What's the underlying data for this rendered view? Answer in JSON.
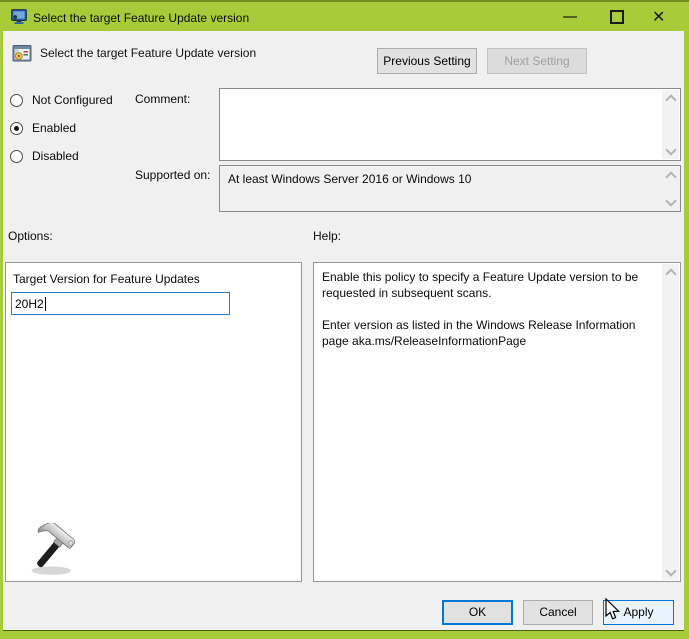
{
  "window": {
    "title": "Select the target Feature Update version",
    "controls": {
      "minimize": "minimize",
      "maximize": "maximize",
      "close": "✕"
    }
  },
  "header": {
    "policy_name": "Select the target Feature Update version",
    "previous_button": "Previous Setting",
    "next_button": "Next Setting"
  },
  "state": {
    "radios": [
      {
        "label": "Not Configured",
        "selected": false
      },
      {
        "label": "Enabled",
        "selected": true
      },
      {
        "label": "Disabled",
        "selected": false
      }
    ],
    "comment_label": "Comment:",
    "comment_value": "",
    "supported_label": "Supported on:",
    "supported_value": "At least Windows Server 2016 or Windows 10"
  },
  "options": {
    "section_label": "Options:",
    "field_label": "Target Version for Feature Updates",
    "field_value": "20H2"
  },
  "help": {
    "section_label": "Help:",
    "paragraphs": [
      "Enable this policy to specify a Feature Update version to be requested in subsequent scans.",
      "Enter version as listed in the Windows Release Information page aka.ms/ReleaseInformationPage"
    ]
  },
  "footer": {
    "ok": "OK",
    "cancel": "Cancel",
    "apply": "Apply"
  },
  "colors": {
    "titlebar_green": "#a7cb39",
    "dialog_bg": "#f0f0f0",
    "accent_blue": "#0078d7",
    "apply_hover_bg": "#e9f3fb"
  }
}
